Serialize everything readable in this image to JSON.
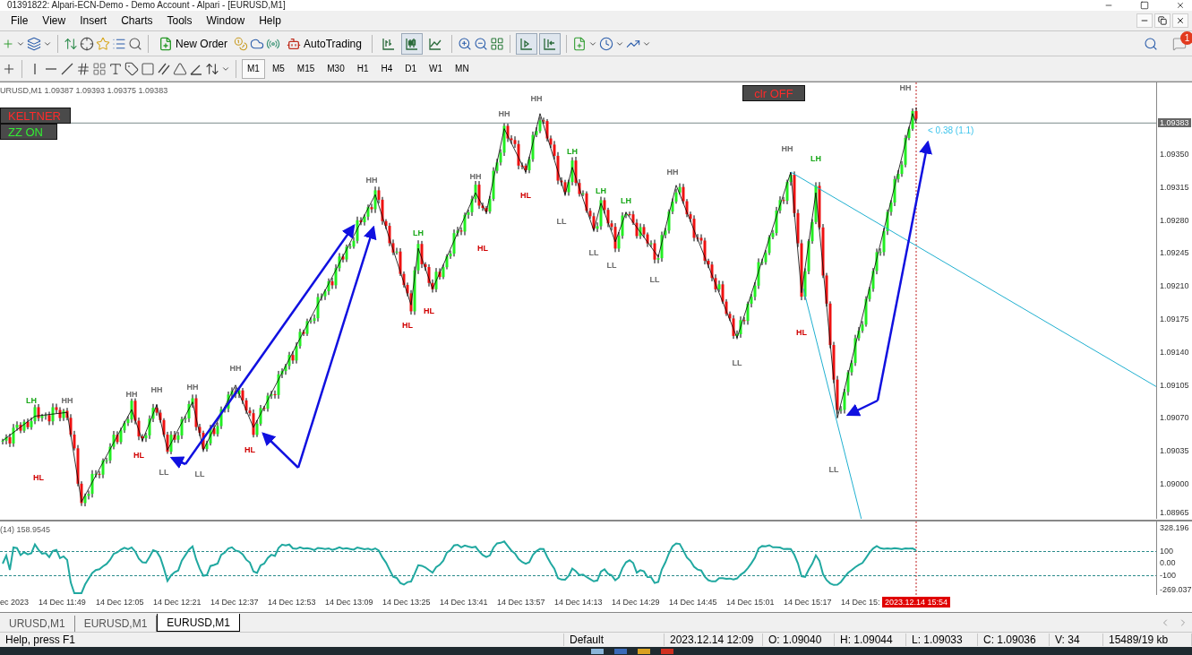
{
  "window": {
    "title": "01391822: Alpari-ECN-Demo - Demo Account - Alpari - [EURUSD,M1]"
  },
  "menu": [
    {
      "label": "File"
    },
    {
      "label": "View"
    },
    {
      "label": "Insert"
    },
    {
      "label": "Charts"
    },
    {
      "label": "Tools"
    },
    {
      "label": "Window"
    },
    {
      "label": "Help"
    }
  ],
  "toolbar": {
    "new_order": "New Order",
    "auto_trading": "AutoTrading",
    "chart_types": [
      {
        "kind": "bars",
        "selected": false
      },
      {
        "kind": "candles",
        "selected": true
      },
      {
        "kind": "line",
        "selected": false
      }
    ],
    "chart_shift": {
      "on": true
    },
    "auto_scroll": {
      "on": true
    },
    "timeframes": [
      {
        "label": "M1",
        "selected": true
      },
      {
        "label": "M5",
        "selected": false
      },
      {
        "label": "M15",
        "selected": false
      },
      {
        "label": "M30",
        "selected": false
      },
      {
        "label": "H1",
        "selected": false
      },
      {
        "label": "H4",
        "selected": false
      },
      {
        "label": "D1",
        "selected": false
      },
      {
        "label": "W1",
        "selected": false
      },
      {
        "label": "MN",
        "selected": false
      }
    ],
    "notifications": "1"
  },
  "chart": {
    "header": "URUSD,M1  1.09387 1.09393 1.09375 1.09383",
    "left_buttons": [
      {
        "label": "KELTNER",
        "on": false
      },
      {
        "label": "ZZ ON",
        "on": true
      }
    ],
    "top_button": {
      "label": "clr OFF",
      "on": false
    },
    "profit_label": "< 0.38 (1.1)",
    "current_price": "1.09383",
    "price_axis": [
      "1.09350",
      "1.09315",
      "1.09280",
      "1.09245",
      "1.09210",
      "1.09175",
      "1.09140",
      "1.09105",
      "1.09070",
      "1.09035",
      "1.09000",
      "1.08965"
    ],
    "time_axis": [
      "ec 2023",
      "14 Dec 11:49",
      "14 Dec 12:05",
      "14 Dec 12:21",
      "14 Dec 12:37",
      "14 Dec 12:53",
      "14 Dec 13:09",
      "14 Dec 13:25",
      "14 Dec 13:41",
      "14 Dec 13:57",
      "14 Dec 14:13",
      "14 Dec 14:29",
      "14 Dec 14:45",
      "14 Dec 15:01",
      "14 Dec 15:17",
      "14 Dec 15:"
    ],
    "cursor_time": "2023.12.14 15:54",
    "zigzag_labels": [
      {
        "text": "LH",
        "color": "#1aa81a"
      },
      {
        "text": "HH",
        "color": "#6a6a6a"
      },
      {
        "text": "HL",
        "color": "#d00000"
      },
      {
        "text": "HH",
        "color": "#6a6a6a"
      },
      {
        "text": "HH",
        "color": "#6a6a6a"
      },
      {
        "text": "HH",
        "color": "#6a6a6a"
      },
      {
        "text": "HL",
        "color": "#d00000"
      },
      {
        "text": "LL",
        "color": "#6a6a6a"
      },
      {
        "text": "LL",
        "color": "#6a6a6a"
      },
      {
        "text": "HH",
        "color": "#6a6a6a"
      },
      {
        "text": "HL",
        "color": "#d00000"
      },
      {
        "text": "HH",
        "color": "#6a6a6a"
      },
      {
        "text": "LH",
        "color": "#1aa81a"
      },
      {
        "text": "HL",
        "color": "#d00000"
      },
      {
        "text": "HL",
        "color": "#d00000"
      },
      {
        "text": "HH",
        "color": "#6a6a6a"
      },
      {
        "text": "HL",
        "color": "#d00000"
      },
      {
        "text": "HH",
        "color": "#6a6a6a"
      },
      {
        "text": "HH",
        "color": "#6a6a6a"
      },
      {
        "text": "HL",
        "color": "#d00000"
      },
      {
        "text": "LH",
        "color": "#1aa81a"
      },
      {
        "text": "LL",
        "color": "#6a6a6a"
      },
      {
        "text": "LH",
        "color": "#1aa81a"
      },
      {
        "text": "LH",
        "color": "#1aa81a"
      },
      {
        "text": "LL",
        "color": "#6a6a6a"
      },
      {
        "text": "LL",
        "color": "#6a6a6a"
      },
      {
        "text": "LL",
        "color": "#6a6a6a"
      },
      {
        "text": "HH",
        "color": "#6a6a6a"
      },
      {
        "text": "LL",
        "color": "#6a6a6a"
      },
      {
        "text": "HH",
        "color": "#6a6a6a"
      },
      {
        "text": "LH",
        "color": "#1aa81a"
      },
      {
        "text": "HL",
        "color": "#d00000"
      },
      {
        "text": "LL",
        "color": "#6a6a6a"
      },
      {
        "text": "HH",
        "color": "#6a6a6a"
      }
    ],
    "indicator": {
      "label": "(14) 158.9545",
      "levels": [
        "328.196",
        "100",
        "0.00",
        "-100",
        "-269.037"
      ]
    }
  },
  "tabs": [
    {
      "label": "URUSD,M1",
      "selected": false
    },
    {
      "label": "EURUSD,M1",
      "selected": false
    },
    {
      "label": "EURUSD,M1",
      "selected": true
    }
  ],
  "status_bar": [
    "Help, press F1",
    "Default",
    "2023.12.14 12:09",
    "O: 1.09040",
    "H: 1.09044",
    "L: 1.09033",
    "C: 1.09036",
    "V: 34",
    "15489/19 kb"
  ]
}
